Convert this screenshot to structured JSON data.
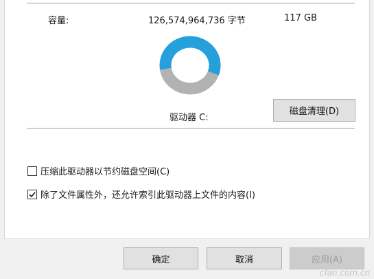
{
  "capacity": {
    "label": "容量:",
    "bytes": "126,574,964,736 字节",
    "gb": "117 GB"
  },
  "usage_chart": {
    "used_fraction": 0.42,
    "used_color": "#b2b2b2",
    "free_color": "#26a0da"
  },
  "drive": {
    "label": "驱动器 C:",
    "cleanup_button": "磁盘清理(D)"
  },
  "options": {
    "compress": {
      "label": "压缩此驱动器以节约磁盘空间(C)",
      "checked": false
    },
    "index": {
      "label": "除了文件属性外，还允许索引此驱动器上文件的内容(I)",
      "checked": true
    }
  },
  "footer": {
    "ok": "确定",
    "cancel": "取消",
    "apply": "应用(A)"
  },
  "watermark": "cfan.com.cn"
}
